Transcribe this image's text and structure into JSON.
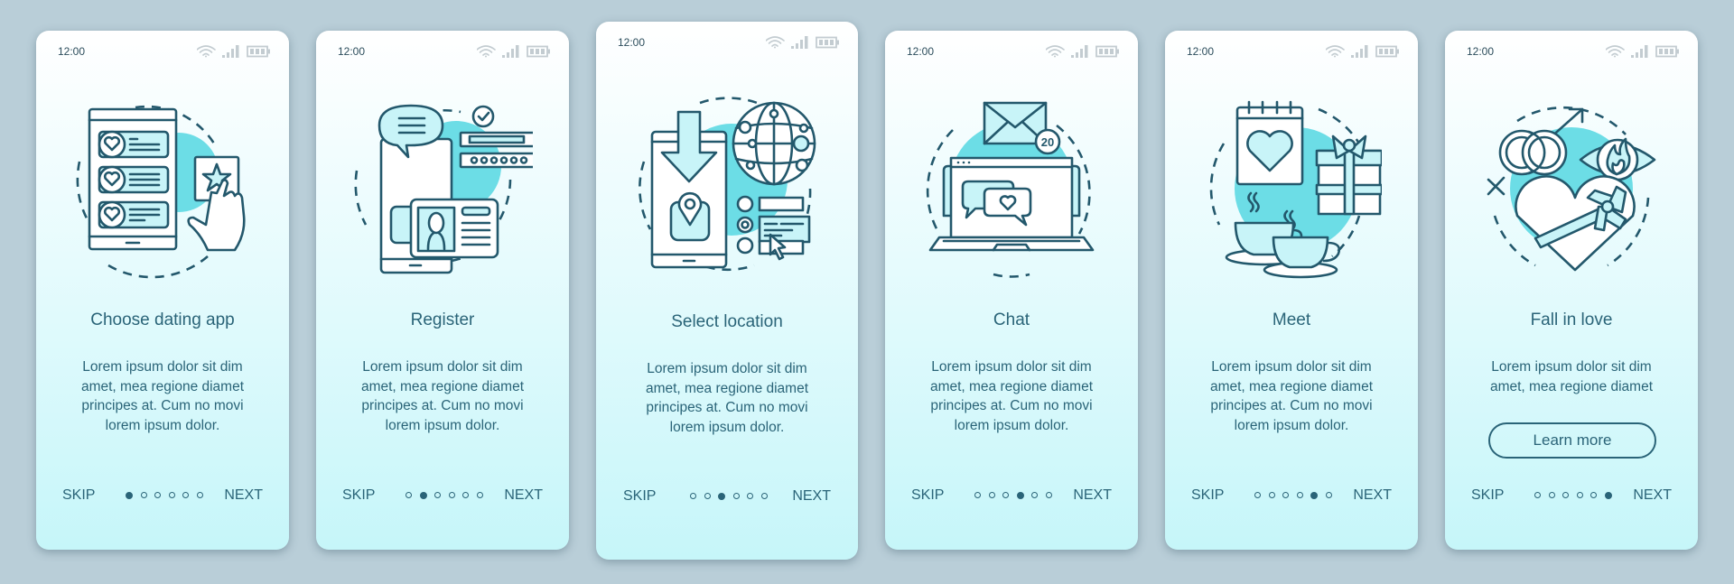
{
  "theme": {
    "background": "#b9ced8",
    "card_top": "#ffffff",
    "card_bottom": "#c6f6f9",
    "text": "#2a6478",
    "accent": "#6cdde6"
  },
  "status_bar": {
    "time": "12:00",
    "icons": [
      "wifi-icon",
      "signal-icon",
      "battery-icon"
    ]
  },
  "nav": {
    "skip_label": "SKIP",
    "next_label": "NEXT",
    "total_pages": 6
  },
  "cards": [
    {
      "title": "Choose dating app",
      "icon": "dating-app-selection-icon",
      "body": [
        "Lorem ipsum dolor sit dim",
        "amet, mea regione diamet",
        "principes at. Cum no movi",
        "lorem ipsum dolor."
      ],
      "active_page": 1
    },
    {
      "title": "Register",
      "icon": "registration-icon",
      "body": [
        "Lorem ipsum dolor sit dim",
        "amet, mea regione diamet",
        "principes at. Cum no movi",
        "lorem ipsum dolor."
      ],
      "active_page": 2
    },
    {
      "title": "Select location",
      "icon": "select-location-icon",
      "body": [
        "Lorem ipsum dolor sit dim",
        "amet, mea regione diamet",
        "principes at. Cum no movi",
        "lorem ipsum dolor."
      ],
      "active_page": 3
    },
    {
      "title": "Chat",
      "icon": "chat-icon",
      "badge": "20",
      "body": [
        "Lorem ipsum dolor sit dim",
        "amet, mea regione diamet",
        "principes at. Cum no movi",
        "lorem ipsum dolor."
      ],
      "active_page": 4
    },
    {
      "title": "Meet",
      "icon": "meet-icon",
      "body": [
        "Lorem ipsum dolor sit dim",
        "amet, mea regione diamet",
        "principes at. Cum no movi",
        "lorem ipsum dolor."
      ],
      "active_page": 5
    },
    {
      "title": "Fall in love",
      "icon": "fall-in-love-icon",
      "body": [
        "Lorem ipsum dolor sit dim",
        "amet, mea regione diamet"
      ],
      "button_label": "Learn more",
      "active_page": 6
    }
  ]
}
